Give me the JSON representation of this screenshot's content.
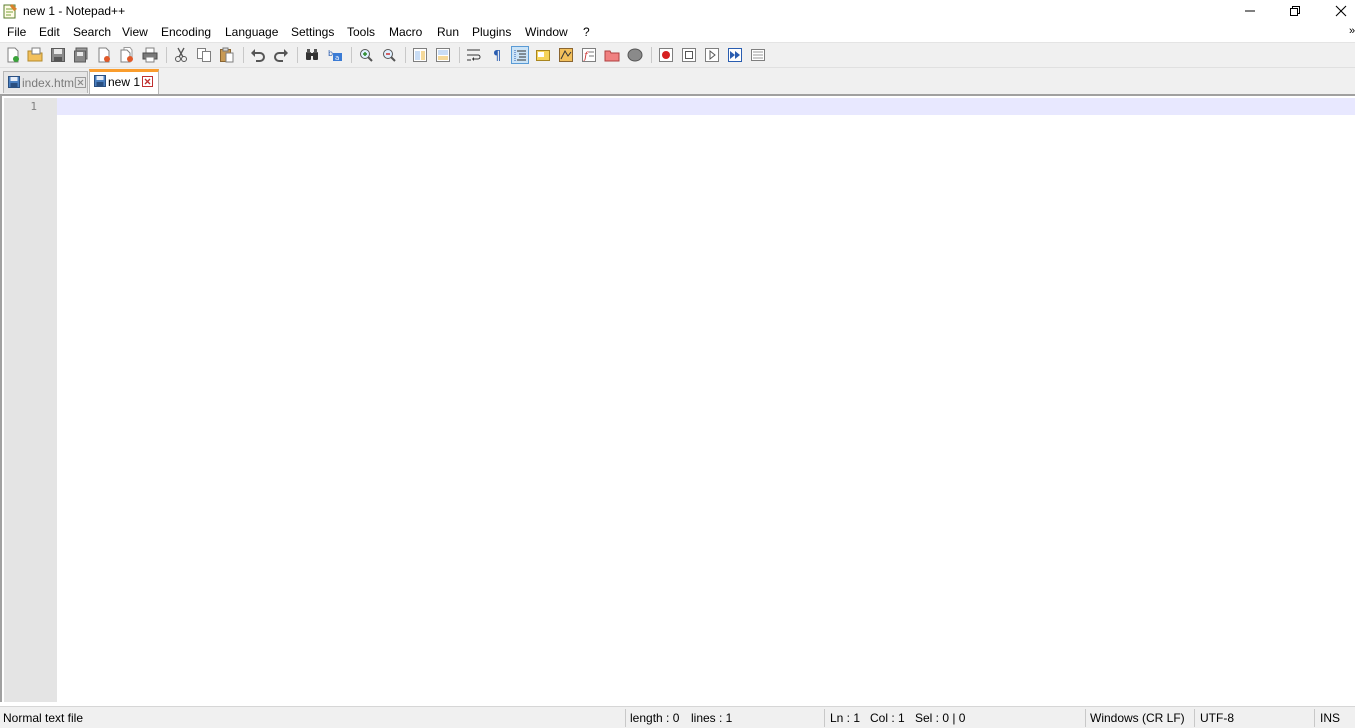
{
  "window": {
    "title": "new 1 - Notepad++"
  },
  "menu": {
    "items": [
      "File",
      "Edit",
      "Search",
      "View",
      "Encoding",
      "Language",
      "Settings",
      "Tools",
      "Macro",
      "Run",
      "Plugins",
      "Window",
      "?"
    ],
    "overflow": "»"
  },
  "tabs": [
    {
      "label": "index.html",
      "active": false
    },
    {
      "label": "new 1",
      "active": true
    }
  ],
  "editor": {
    "line_numbers": [
      "1"
    ],
    "caret_line_color": "#e8e8ff",
    "content": ""
  },
  "status": {
    "file_type": "Normal text file",
    "length": "length : 0",
    "lines": "lines : 1",
    "ln": "Ln : 1",
    "col": "Col : 1",
    "sel": "Sel : 0 | 0",
    "eol": "Windows (CR LF)",
    "encoding": "UTF-8",
    "mode": "INS"
  },
  "colors": {
    "active_tab_accent": "#fa9d2d",
    "toolbar_bg": "#f0f0f0",
    "gutter_bg": "#e4e4e4"
  },
  "icons": {
    "toolbar": [
      "new-file-icon",
      "open-file-icon",
      "save-icon",
      "save-all-icon",
      "close-icon",
      "close-all-icon",
      "print-icon",
      "cut-icon",
      "copy-icon",
      "paste-icon",
      "undo-icon",
      "redo-icon",
      "find-icon",
      "replace-icon",
      "zoom-in-icon",
      "zoom-out-icon",
      "sync-vertical-icon",
      "sync-horizontal-icon",
      "word-wrap-icon",
      "show-all-chars-icon",
      "indent-guide-icon",
      "udl-icon",
      "doc-map-icon",
      "function-list-icon",
      "folder-workspace-icon",
      "monitoring-icon",
      "record-macro-icon",
      "stop-record-icon",
      "play-macro-icon",
      "run-macro-multiple-icon",
      "save-macro-icon"
    ]
  }
}
